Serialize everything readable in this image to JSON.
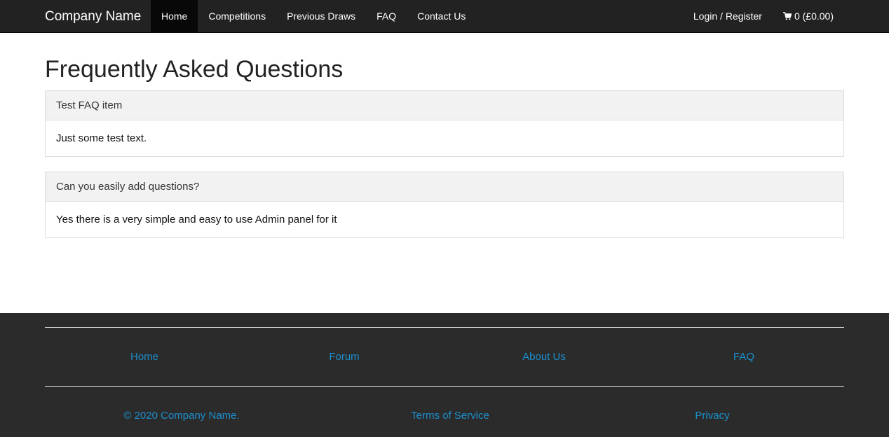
{
  "navbar": {
    "brand": "Company Name",
    "items": [
      {
        "label": "Home",
        "active": true
      },
      {
        "label": "Competitions",
        "active": false
      },
      {
        "label": "Previous Draws",
        "active": false
      },
      {
        "label": "FAQ",
        "active": false
      },
      {
        "label": "Contact Us",
        "active": false
      }
    ],
    "login_label": "Login / Register",
    "cart_label": "0 (£0.00)",
    "cart_icon": "cart-icon"
  },
  "main": {
    "title": "Frequently Asked Questions",
    "faqs": [
      {
        "question": "Test FAQ item",
        "answer": "Just some test text."
      },
      {
        "question": "Can you easily add questions?",
        "answer": "Yes there is a very simple and easy to use Admin panel for it"
      }
    ]
  },
  "footer": {
    "links": [
      "Home",
      "Forum",
      "About Us",
      "FAQ"
    ],
    "copyright": "© 2020 Company Name.",
    "terms": "Terms of Service",
    "privacy": "Privacy"
  },
  "colors": {
    "navbar_bg": "#222222",
    "footer_bg": "#2b2b2b",
    "link": "#1c8fcc",
    "panel_heading_bg": "#f2f2f2"
  }
}
